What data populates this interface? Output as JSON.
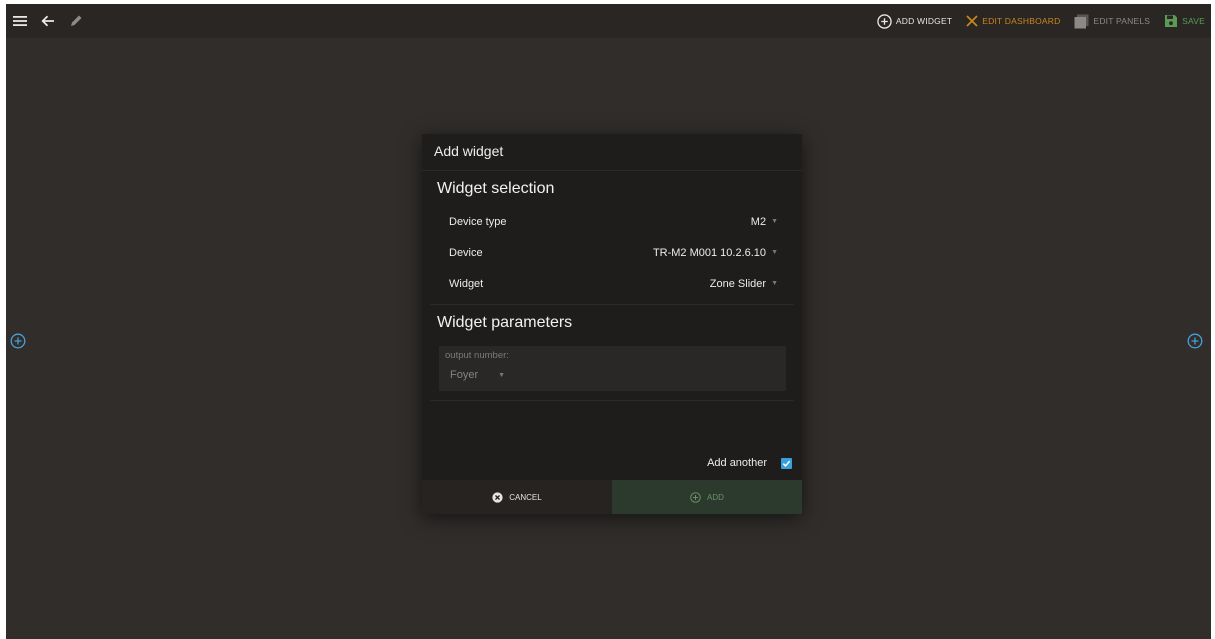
{
  "toolbar": {
    "menu_icon": "menu-icon",
    "back_icon": "arrow-left-icon",
    "edit_icon": "pencil-icon",
    "add_widget_label": "ADD WIDGET",
    "edit_dashboard_label": "EDIT DASHBOARD",
    "edit_panels_label": "EDIT PANELS",
    "save_label": "SAVE"
  },
  "dialog": {
    "title": "Add widget",
    "selection_title": "Widget selection",
    "rows": [
      {
        "label": "Device type",
        "value": "M2"
      },
      {
        "label": "Device",
        "value": "TR-M2 M001 10.2.6.10"
      },
      {
        "label": "Widget",
        "value": "Zone Slider"
      }
    ],
    "params_title": "Widget parameters",
    "param": {
      "label": "output number:",
      "value": "Foyer"
    },
    "add_another_label": "Add another",
    "add_another_checked": true,
    "cancel_label": "CANCEL",
    "add_label": "ADD"
  },
  "colors": {
    "accent_orange": "#c8871c",
    "accent_green": "#5a9c55",
    "checkbox_blue": "#3aa0dc",
    "side_add_blue": "#4a9fd8"
  }
}
